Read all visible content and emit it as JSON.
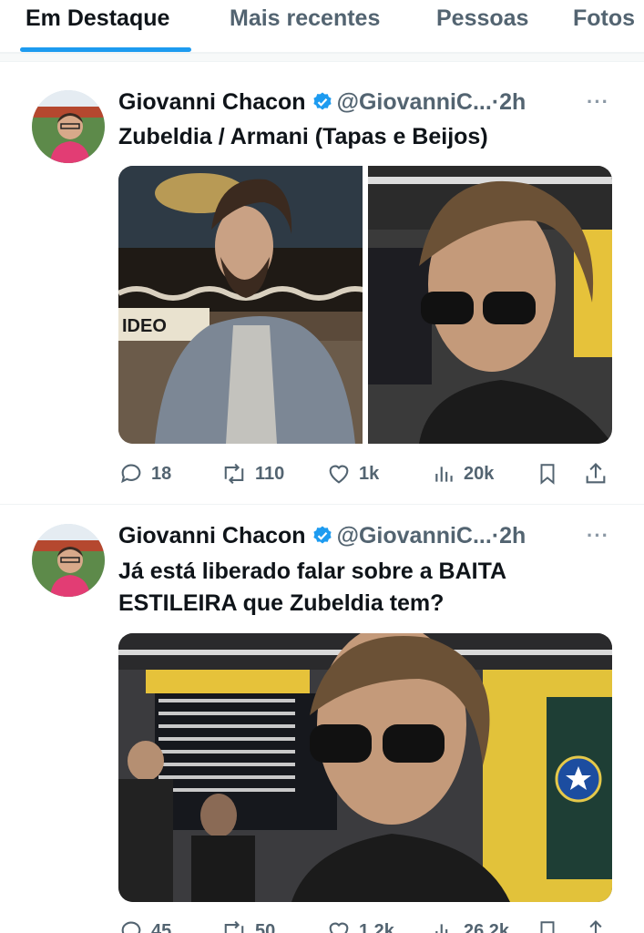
{
  "tabs": [
    {
      "label": "Em Destaque",
      "active": true
    },
    {
      "label": "Mais recentes",
      "active": false
    },
    {
      "label": "Pessoas",
      "active": false
    },
    {
      "label": "Fotos",
      "active": false
    }
  ],
  "colors": {
    "accent": "#1d9bf0",
    "text": "#0f1419",
    "muted": "#536471"
  },
  "tweets": [
    {
      "author": "Giovanni Chacon",
      "verified": true,
      "handle": "@GiovanniC...",
      "dot": "·",
      "time": "2h",
      "more_icon": "more-horizontal-icon",
      "text": "Zubeldia / Armani (Tapas e Beijos)",
      "media_images": [
        "photo-man-denim-jacket",
        "photo-man-sunglasses-airport"
      ],
      "image_sign": "IDEO",
      "stats": {
        "replies": "18",
        "reposts": "110",
        "likes": "1k",
        "views": "20k"
      }
    },
    {
      "author": "Giovanni Chacon",
      "verified": true,
      "handle": "@GiovanniC...",
      "dot": "·",
      "time": "2h",
      "more_icon": "more-horizontal-icon",
      "text_line1": "Já está liberado falar sobre a BAITA",
      "text_line2": "ESTILEIRA que Zubeldia tem?",
      "media_images": [
        "photo-man-sunglasses-airport-board"
      ],
      "stats": {
        "replies": "45",
        "reposts": "50",
        "likes": "1,2k",
        "views": "26,2k"
      }
    }
  ]
}
